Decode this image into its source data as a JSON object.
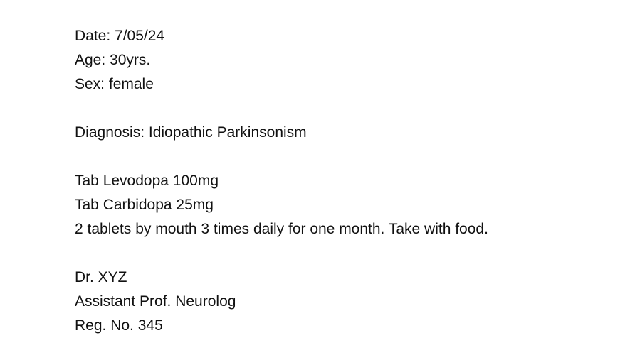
{
  "patient": {
    "date": "Date: 7/05/24",
    "age": "Age: 30yrs.",
    "sex": "Sex: female"
  },
  "diagnosis": "Diagnosis: Idiopathic Parkinsonism",
  "prescription": {
    "items": [
      "Tab Levodopa 100mg",
      "Tab Carbidopa 25mg"
    ],
    "instructions": "2 tablets by mouth 3 times daily for one month. Take with food."
  },
  "doctor": {
    "name": "Dr. XYZ",
    "title": "Assistant Prof. Neurolog",
    "registration": "Reg. No. 345"
  }
}
